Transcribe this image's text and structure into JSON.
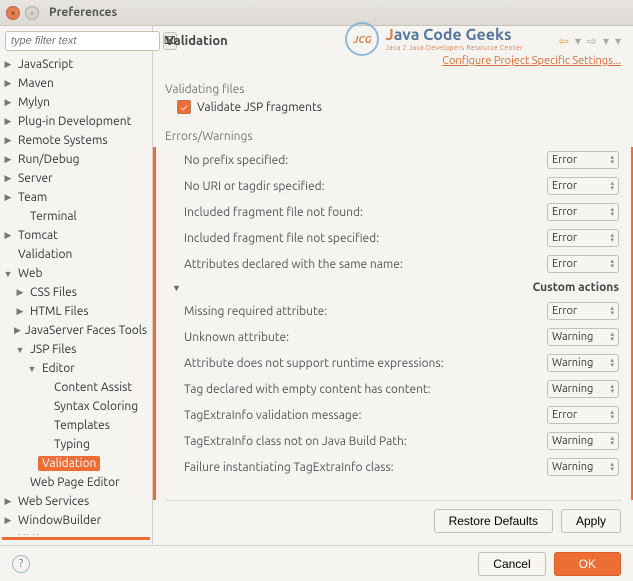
{
  "window": {
    "title": "Preferences"
  },
  "filter": {
    "placeholder": "type filter text"
  },
  "tree": [
    {
      "label": "JavaScript",
      "expand": true,
      "indent": 0
    },
    {
      "label": "Maven",
      "expand": true,
      "indent": 0
    },
    {
      "label": "Mylyn",
      "expand": true,
      "indent": 0
    },
    {
      "label": "Plug-in Development",
      "expand": true,
      "indent": 0
    },
    {
      "label": "Remote Systems",
      "expand": true,
      "indent": 0
    },
    {
      "label": "Run/Debug",
      "expand": true,
      "indent": 0
    },
    {
      "label": "Server",
      "expand": true,
      "indent": 0
    },
    {
      "label": "Team",
      "expand": true,
      "indent": 0
    },
    {
      "label": "Terminal",
      "expand": false,
      "indent": 1
    },
    {
      "label": "Tomcat",
      "expand": true,
      "indent": 0
    },
    {
      "label": "Validation",
      "expand": false,
      "indent": 0
    },
    {
      "label": "Web",
      "expand": true,
      "indent": 0,
      "open": true
    },
    {
      "label": "CSS Files",
      "expand": true,
      "indent": 1
    },
    {
      "label": "HTML Files",
      "expand": true,
      "indent": 1
    },
    {
      "label": "JavaServer Faces Tools",
      "expand": true,
      "indent": 1
    },
    {
      "label": "JSP Files",
      "expand": true,
      "indent": 1,
      "open": true
    },
    {
      "label": "Editor",
      "expand": true,
      "indent": 2,
      "open": true
    },
    {
      "label": "Content Assist",
      "expand": false,
      "indent": 3
    },
    {
      "label": "Syntax Coloring",
      "expand": false,
      "indent": 3
    },
    {
      "label": "Templates",
      "expand": false,
      "indent": 3
    },
    {
      "label": "Typing",
      "expand": false,
      "indent": 3
    },
    {
      "label": "Validation",
      "expand": false,
      "indent": 2,
      "selected": true
    },
    {
      "label": "Web Page Editor",
      "expand": false,
      "indent": 1
    },
    {
      "label": "Web Services",
      "expand": true,
      "indent": 0
    },
    {
      "label": "WindowBuilder",
      "expand": true,
      "indent": 0
    },
    {
      "label": "XML",
      "expand": true,
      "indent": 0
    }
  ],
  "main": {
    "heading": "Validation",
    "configure_link": "Configure Project Specific Settings...",
    "validating_section": "Validating files",
    "validate_jsp_label": "Validate JSP fragments",
    "errors_section": "Errors/Warnings",
    "custom_actions": "Custom actions",
    "rows": [
      {
        "label": "No prefix specified:",
        "value": "Error"
      },
      {
        "label": "No URI or tagdir specified:",
        "value": "Error"
      },
      {
        "label": "Included fragment file not found:",
        "value": "Error"
      },
      {
        "label": "Included fragment file not specified:",
        "value": "Error"
      },
      {
        "label": "Attributes declared with the same name:",
        "value": "Error"
      }
    ],
    "custom_rows": [
      {
        "label": "Missing required attribute:",
        "value": "Error"
      },
      {
        "label": "Unknown attribute:",
        "value": "Warning"
      },
      {
        "label": "Attribute does not support runtime expressions:",
        "value": "Warning"
      },
      {
        "label": "Tag declared with empty content has content:",
        "value": "Warning"
      },
      {
        "label": "TagExtraInfo validation message:",
        "value": "Error"
      },
      {
        "label": "TagExtraInfo class not on Java Build Path:",
        "value": "Warning"
      },
      {
        "label": "Failure instantiating TagExtraInfo class:",
        "value": "Warning"
      }
    ],
    "restore": "Restore Defaults",
    "apply": "Apply"
  },
  "footer": {
    "cancel": "Cancel",
    "ok": "OK"
  },
  "watermark": {
    "initials": "JCG",
    "line1a": "J",
    "line1b": "ava Code Geeks",
    "line2": "Java 2 Java Developers Resource Center"
  }
}
